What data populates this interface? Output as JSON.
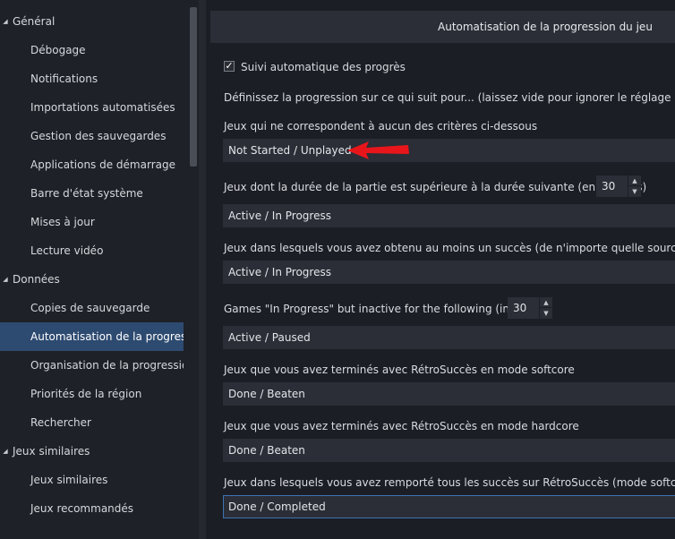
{
  "sidebar": {
    "groups": [
      {
        "label": "Général",
        "items": [
          "Débogage",
          "Notifications",
          "Importations automatisées",
          "Gestion des sauvegardes",
          "Applications de démarrage",
          "Barre d'état système",
          "Mises à jour",
          "Lecture vidéo"
        ]
      },
      {
        "label": "Données",
        "items": [
          "Copies de sauvegarde",
          "Automatisation de la progressio",
          "Organisation de la progression c",
          "Priorités de la région",
          "Rechercher"
        ]
      },
      {
        "label": "Jeux similaires",
        "items": [
          "Jeux similaires",
          "Jeux recommandés"
        ]
      }
    ],
    "selected_item": "Automatisation de la progressio"
  },
  "main": {
    "title": "Automatisation de la progression du jeu",
    "auto_track": {
      "label": "Suivi automatique des progrès",
      "checked": true,
      "check_glyph": "✓"
    },
    "description": "Définissez la progression sur ce qui suit pour... (laissez vide pour ignorer le réglage automatique",
    "rules": [
      {
        "label": "Jeux qui ne correspondent à aucun des critères ci-dessous",
        "value": "Not Started / Unplayed"
      },
      {
        "label": "Jeux dont la durée de la partie est supérieure à la durée suivante (en minutes)",
        "spinner": "30",
        "value": "Active / In Progress"
      },
      {
        "label": "Jeux dans lesquels vous avez obtenu au moins un succès (de n'importe quelle source)",
        "value": "Active / In Progress"
      },
      {
        "label": "Games \"In Progress\" but inactive for the following (in days)",
        "spinner": "30",
        "value": "Active / Paused"
      },
      {
        "label": "Jeux que vous avez terminés avec RétroSuccès en mode softcore",
        "value": "Done / Beaten"
      },
      {
        "label": "Jeux que vous avez terminés avec RétroSuccès en mode hardcore",
        "value": "Done / Beaten"
      },
      {
        "label": "Jeux dans lesquels vous avez remporté tous les succès sur RétroSuccès (mode softcore)",
        "value": "Done / Completed"
      }
    ]
  },
  "icons": {
    "expanded_arrow": "◢",
    "spin_up": "▲",
    "spin_down": "▼"
  },
  "colors": {
    "sidebar_bg": "#1e2127",
    "main_bg": "#1b1e24",
    "field_bg": "#2b2e36",
    "selected_bg": "#2d4a70",
    "focus_border": "#3e72b3",
    "annotation_arrow": "#e8161b"
  }
}
